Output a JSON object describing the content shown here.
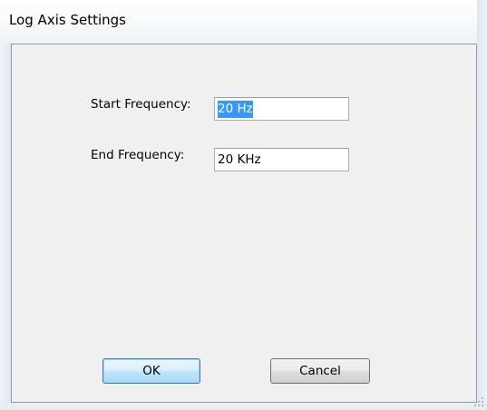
{
  "window": {
    "title": "Log Axis Settings"
  },
  "form": {
    "start_label": "Start Frequency:",
    "start_value": "20 Hz",
    "end_label": "End Frequency:",
    "end_value": "20 KHz"
  },
  "buttons": {
    "ok_label": "OK",
    "cancel_label": "Cancel"
  },
  "icons": {
    "resize_grip": "resize-grip-icon"
  },
  "colors": {
    "selection": "#3399ff",
    "client_background": "#f0f0f0",
    "default_button_border": "#3c7fb1"
  }
}
